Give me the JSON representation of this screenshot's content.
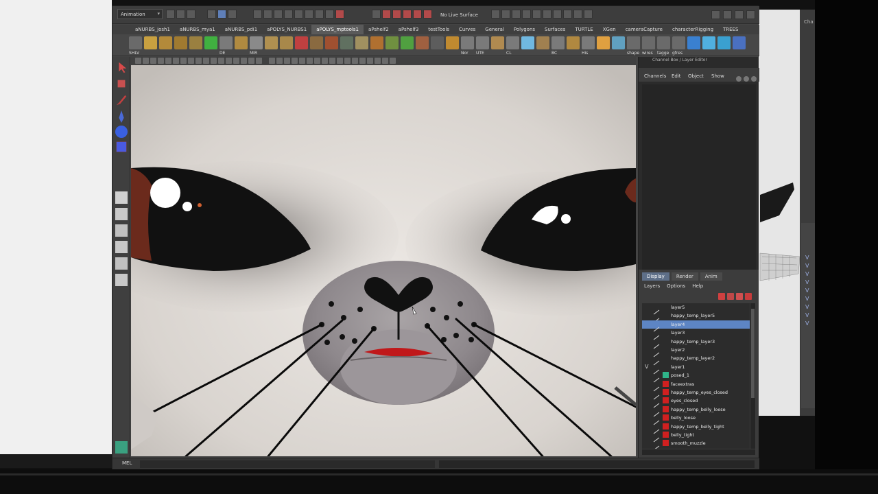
{
  "window": {
    "mode": "Animation",
    "live_surface_label": "No Live Surface"
  },
  "shelf_tabs": [
    {
      "label": "aNURBS_josh1",
      "active": false
    },
    {
      "label": "aNURBS_mya1",
      "active": false
    },
    {
      "label": "aNURBS_pdi1",
      "active": false
    },
    {
      "label": "aPOLYS_NURBS1",
      "active": false
    },
    {
      "label": "aPOLYS_mptools1",
      "active": true
    },
    {
      "label": "aPshelf2",
      "active": false
    },
    {
      "label": "aPshelf3",
      "active": false
    },
    {
      "label": "testTools",
      "active": false
    },
    {
      "label": "Curves",
      "active": false
    },
    {
      "label": "General",
      "active": false
    },
    {
      "label": "Polygons",
      "active": false
    },
    {
      "label": "Surfaces",
      "active": false
    },
    {
      "label": "TURTLE",
      "active": false
    },
    {
      "label": "XGen",
      "active": false
    },
    {
      "label": "cameraCapture",
      "active": false
    },
    {
      "label": "characterRigging",
      "active": false
    },
    {
      "label": "TREES",
      "active": false
    }
  ],
  "shelf_labels": {
    "shlv": "SHLV",
    "de": "DE",
    "mir": "MIR",
    "nor": "Nor",
    "ute": "UTE",
    "cl": "CL",
    "bc": "BC",
    "his": "His"
  },
  "shelf_right_labels": [
    "shape",
    "wires",
    "tagge",
    "gfres"
  ],
  "channel_box": {
    "title": "Channel Box / Layer Editor",
    "menu": [
      "Channels",
      "Edit",
      "Object",
      "Show"
    ]
  },
  "layer_editor": {
    "tabs": [
      "Display",
      "Render",
      "Anim"
    ],
    "active_tab": "Display",
    "menu": [
      "Layers",
      "Options",
      "Help"
    ],
    "layers": [
      {
        "name": "layer5",
        "visible": "",
        "color": "",
        "selected": false
      },
      {
        "name": "happy_temp_layer5",
        "visible": "",
        "color": "",
        "selected": false
      },
      {
        "name": "layer4",
        "visible": "",
        "color": "",
        "selected": true
      },
      {
        "name": "layer3",
        "visible": "",
        "color": "",
        "selected": false
      },
      {
        "name": "happy_temp_layer3",
        "visible": "",
        "color": "",
        "selected": false
      },
      {
        "name": "layer2",
        "visible": "",
        "color": "",
        "selected": false
      },
      {
        "name": "happy_temp_layer2",
        "visible": "",
        "color": "",
        "selected": false
      },
      {
        "name": "layer1",
        "visible": "V",
        "color": "",
        "selected": false
      },
      {
        "name": "posed_1",
        "visible": "",
        "color": "#2fb58a",
        "selected": false
      },
      {
        "name": "faceextras",
        "visible": "",
        "color": "#d02020",
        "selected": false
      },
      {
        "name": "happy_temp_eyes_closed",
        "visible": "",
        "color": "#d02020",
        "selected": false
      },
      {
        "name": "eyes_closed",
        "visible": "",
        "color": "#d02020",
        "selected": false
      },
      {
        "name": "happy_temp_belly_loose",
        "visible": "",
        "color": "#d02020",
        "selected": false
      },
      {
        "name": "belly_loose",
        "visible": "",
        "color": "#d02020",
        "selected": false
      },
      {
        "name": "happy_temp_belly_tight",
        "visible": "",
        "color": "#d02020",
        "selected": false
      },
      {
        "name": "belly_tight",
        "visible": "",
        "color": "#d02020",
        "selected": false
      },
      {
        "name": "smooth_muzzle",
        "visible": "",
        "color": "#d02020",
        "selected": false
      }
    ]
  },
  "command_line": {
    "label": "MEL"
  },
  "background_window": {
    "label": "Cha",
    "layer_checks": [
      "V",
      "V",
      "V",
      "V",
      "V",
      "V",
      "V",
      "V",
      "V"
    ]
  },
  "colors": {
    "accent_selection": "#5d85c4",
    "layer_red": "#d02020",
    "layer_green": "#2fb58a"
  }
}
